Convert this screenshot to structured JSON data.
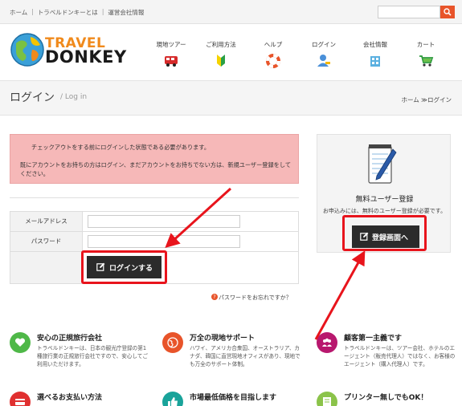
{
  "topnav": {
    "items": [
      "ホーム",
      "トラベルドンキーとは",
      "運営会社情報"
    ],
    "separator": "|"
  },
  "search": {
    "placeholder": ""
  },
  "logo": {
    "line1": "TRAVEL",
    "line2": "DONKEY"
  },
  "mainnav": [
    {
      "label": "現地ツアー",
      "icon": "bus-icon"
    },
    {
      "label": "ご利用方法",
      "icon": "beginner-mark-icon"
    },
    {
      "label": "ヘルプ",
      "icon": "lifebuoy-icon"
    },
    {
      "label": "ログイン",
      "icon": "user-login-icon"
    },
    {
      "label": "会社情報",
      "icon": "building-icon"
    },
    {
      "label": "カート",
      "icon": "cart-icon"
    }
  ],
  "page": {
    "title": "ログイン",
    "subtitle": "/ Log in"
  },
  "breadcrumb": {
    "home": "ホーム",
    "sep": "≫",
    "current": "ログイン"
  },
  "notice": {
    "line1": "チェックアウトをする前にログインした状態である必要があります。",
    "line2": "既にアカウントをお持ちの方はログイン、まだアカウントをお持ちでない方は、新規ユーザー登録をしてください。"
  },
  "login_form": {
    "email_label": "メールアドレス",
    "email_value": "",
    "password_label": "パスワード",
    "password_value": "",
    "submit_label": "ログインする",
    "forgot_label": "パスワードをお忘れですか？"
  },
  "register": {
    "title": "無料ユーザー登録",
    "subtitle": "お申込みには、無料のユーザー登録が必要です。",
    "button_label": "登録画面へ"
  },
  "features": [
    {
      "title": "安心の正規旅行会社",
      "desc": "トラベルドンキーは、日本の観光庁登録の第1種旅行業の正規旅行会社ですので、安心してご利用いただけます。",
      "color": "#4fb848",
      "icon": "heart-icon"
    },
    {
      "title": "万全の現地サポート",
      "desc": "ハワイ、アメリカ合衆国、オーストラリア、カナダ、韓国に直営現地オフィスがあり、現地でも万全のサポート体制。",
      "color": "#e8542a",
      "icon": "globe-icon"
    },
    {
      "title": "顧客第一主義です",
      "desc": "トラベルドンキーは、ツアー会社、ホテルのエージェント（販売代理人）ではなく、お客様のエージェント（購入代理人）です。",
      "color": "#b8186e",
      "icon": "users-icon"
    },
    {
      "title": "選べるお支払い方法",
      "desc": "",
      "color": "#e03030",
      "icon": "card-icon"
    },
    {
      "title": "市場最低価格を目指します",
      "desc": "",
      "color": "#19a39a",
      "icon": "thumbs-up-icon"
    },
    {
      "title": "プリンター無しでもOK！",
      "desc": "",
      "color": "#8bc34a",
      "icon": "voucher-icon"
    }
  ],
  "colors": {
    "accent": "#e8542a",
    "highlight": "#e8141c",
    "notice_bg": "#f6b8b8",
    "button": "#2b2b2b"
  }
}
